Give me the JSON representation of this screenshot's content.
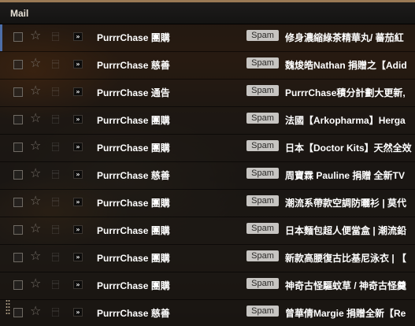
{
  "header": {
    "title": "Mail"
  },
  "icons": {
    "checkbox": "checkbox-icon",
    "star": "star-icon",
    "importance": "importance-marker-icon",
    "dragger": "drag-handle-icon"
  },
  "colors": {
    "accent": "#4d6ea8",
    "label_bg": "#c7c5c2",
    "header_bg": "#161514"
  },
  "emails": [
    {
      "sender": "PurrrChase 團購",
      "label": "Spam",
      "subject": "修身濃縮綠茶精華丸/ 蕃茄紅"
    },
    {
      "sender": "PurrrChase 慈善",
      "label": "Spam",
      "subject": "魏焌皓Nathan 捐贈之【Adid"
    },
    {
      "sender": "PurrrChase 通告",
      "label": "Spam",
      "subject": "PurrrChase積分計劃大更新,"
    },
    {
      "sender": "PurrrChase 團購",
      "label": "Spam",
      "subject": "法國【Arkopharma】Herga"
    },
    {
      "sender": "PurrrChase 團購",
      "label": "Spam",
      "subject": "日本【Doctor Kits】天然全效"
    },
    {
      "sender": "PurrrChase 慈善",
      "label": "Spam",
      "subject": "周寶霖 Pauline 捐贈 全新TV"
    },
    {
      "sender": "PurrrChase 團購",
      "label": "Spam",
      "subject": "潮流系帶款空調防曬衫 | 莫代"
    },
    {
      "sender": "PurrrChase 團購",
      "label": "Spam",
      "subject": "日本麵包超人便當盒 | 潮流鉛"
    },
    {
      "sender": "PurrrChase 團購",
      "label": "Spam",
      "subject": "新款高腰復古比基尼泳衣 | 【"
    },
    {
      "sender": "PurrrChase 團購",
      "label": "Spam",
      "subject": "神奇古怪驅蚊草 / 神奇古怪羹"
    },
    {
      "sender": "PurrrChase 慈善",
      "label": "Spam",
      "subject": "曾華倩Margie 捐贈全新【Re"
    }
  ]
}
